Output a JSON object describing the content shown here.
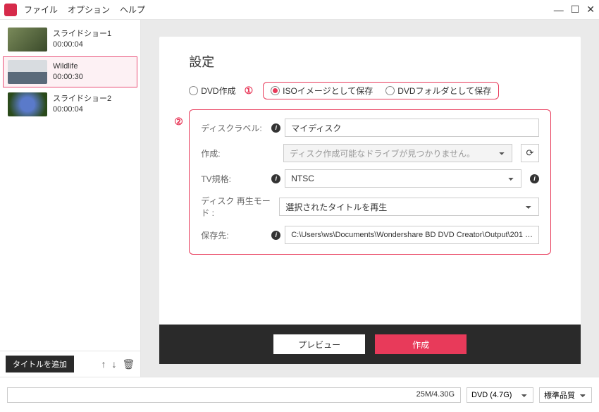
{
  "menubar": {
    "file": "ファイル",
    "options": "オプション",
    "help": "ヘルプ"
  },
  "sidebar": {
    "items": [
      {
        "title": "スライドショー1",
        "duration": "00:00:04"
      },
      {
        "title": "Wildlife",
        "duration": "00:00:30"
      },
      {
        "title": "スライドショー2",
        "duration": "00:00:04"
      }
    ],
    "add_title": "タイトルを追加"
  },
  "callouts": {
    "one": "①",
    "two": "②"
  },
  "settings": {
    "title": "設定",
    "radio_dvd": "DVD作成",
    "radio_iso": "ISOイメージとして保存",
    "radio_folder": "DVDフォルダとして保存",
    "label_disc": "ディスクラベル:",
    "value_disc": "マイディスク",
    "label_create": "作成:",
    "value_create": "ディスク作成可能なドライブが見つかりません。",
    "label_tv": "TV規格:",
    "value_tv": "NTSC",
    "label_mode": "ディスク 再生モード :",
    "value_mode": "選択されたタイトルを再生",
    "label_dest": "保存先:",
    "value_dest": "C:\\Users\\ws\\Documents\\Wondershare BD DVD Creator\\Output\\201 …"
  },
  "footer": {
    "preview": "プレビュー",
    "create": "作成"
  },
  "statusbar": {
    "progress": "25M/4.30G",
    "disc_type": "DVD (4.7G)",
    "quality": "標準品質"
  }
}
